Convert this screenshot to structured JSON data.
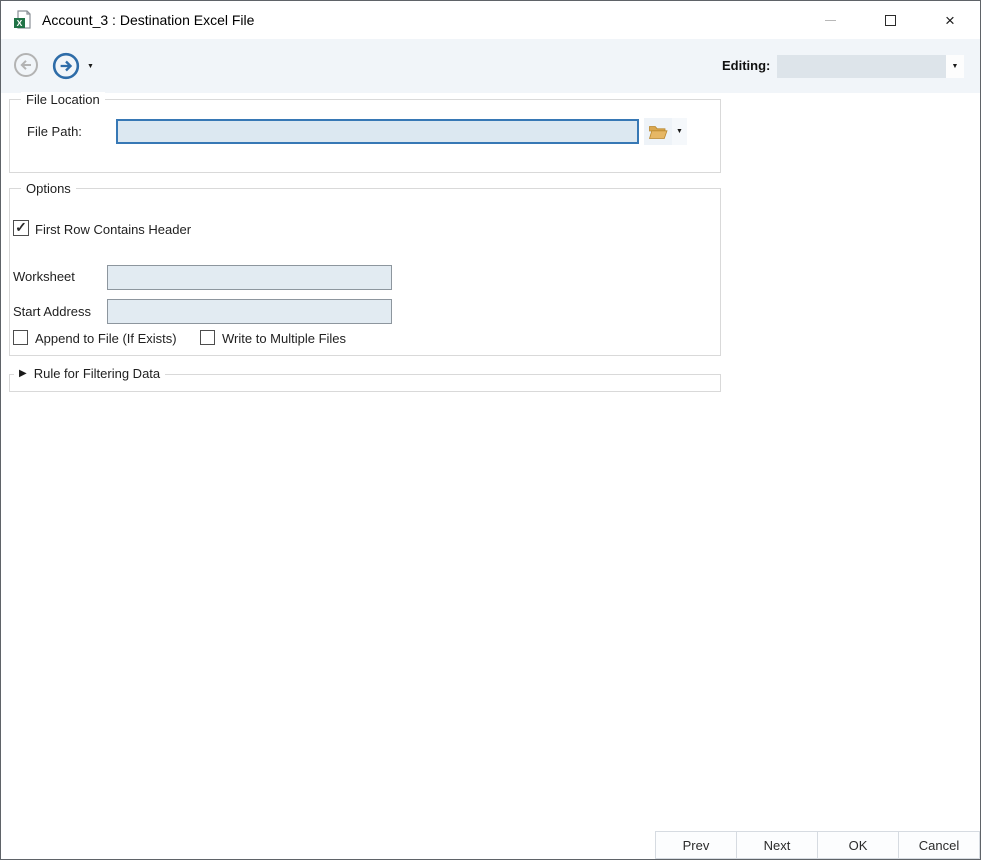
{
  "window": {
    "title": "Account_3 : Destination Excel File"
  },
  "icons": {
    "check": "✓",
    "caret_down": "▼",
    "collapsed_arrow": "▶",
    "close": "×"
  },
  "toolbar": {
    "editing_label": "Editing:",
    "editing_value": ""
  },
  "file_location": {
    "legend": "File Location",
    "file_path_label": "File Path:",
    "file_path_value": ""
  },
  "options": {
    "legend": "Options",
    "first_row_header_label": "First Row Contains Header",
    "worksheet_label": "Worksheet",
    "worksheet_value": "",
    "start_address_label": "Start Address",
    "start_address_value": "",
    "append_label": "Append to File (If Exists)",
    "write_multiple_label": "Write to Multiple Files"
  },
  "filter_section": {
    "legend": "Rule for Filtering Data"
  },
  "footer": {
    "prev": "Prev",
    "next": "Next",
    "ok": "OK",
    "cancel": "Cancel"
  },
  "colors": {
    "toolbar_bg": "#f1f5f9",
    "input_bg": "#e2ebf2",
    "focused_input_bg": "#dce8f1",
    "focused_border": "#3778b5",
    "accent_blue": "#2e6ca8",
    "folder_gold": "#dba850",
    "excel_green": "#217346"
  }
}
